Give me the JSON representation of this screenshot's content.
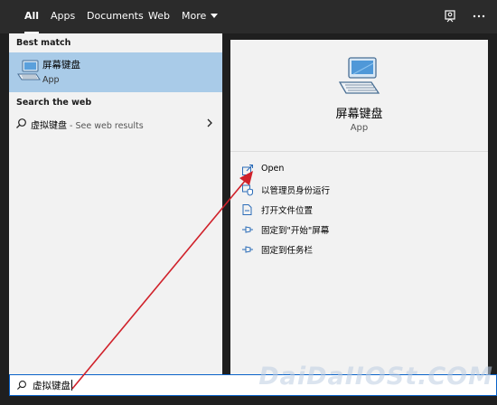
{
  "tabs": [
    {
      "label": "All"
    },
    {
      "label": "Apps"
    },
    {
      "label": "Documents"
    },
    {
      "label": "Web"
    },
    {
      "label": "More"
    }
  ],
  "left": {
    "best_match_title": "Best match",
    "best_match": {
      "name": "屏幕键盘",
      "type": "App"
    },
    "web_title": "Search the web",
    "web_result": {
      "query": "虚拟键盘",
      "hint": " - See web results"
    }
  },
  "right": {
    "name": "屏幕键盘",
    "type": "App",
    "actions": [
      {
        "label": "Open",
        "icon": "open-icon"
      },
      {
        "label": "以管理员身份运行",
        "icon": "shield-icon"
      },
      {
        "label": "打开文件位置",
        "icon": "file-location-icon"
      },
      {
        "label": "固定到\"开始\"屏幕",
        "icon": "pin-icon"
      },
      {
        "label": "固定到任务栏",
        "icon": "pin-icon"
      }
    ]
  },
  "search": {
    "value": "虚拟键盘"
  },
  "watermark": "DaiDaIIOSt.COM",
  "colors": {
    "topbar": "#2b2b2b",
    "selected": "#a9cbe8",
    "pane": "#f2f2f2",
    "accent": "#0a63c9",
    "arrow": "#d0212a"
  }
}
